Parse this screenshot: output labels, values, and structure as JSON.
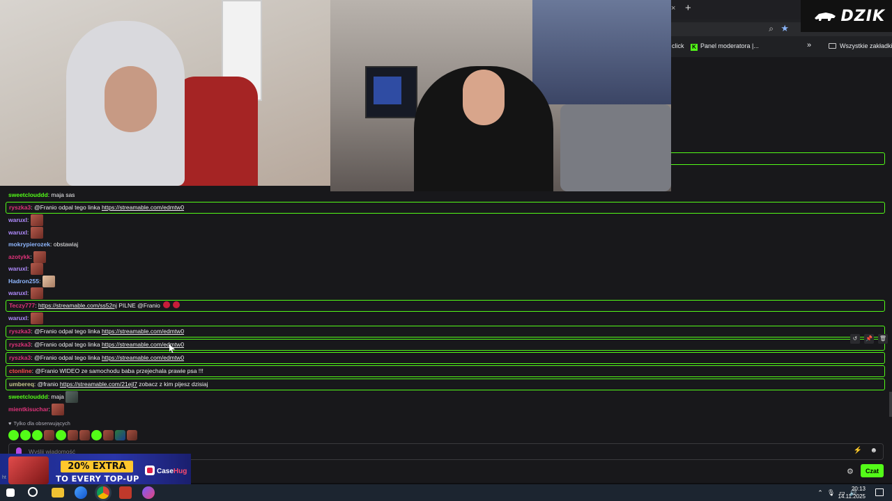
{
  "browser": {
    "tab_close": "×",
    "new_tab": "+",
    "bookmarks": {
      "click": "click",
      "panel": "Panel moderatora |...",
      "more": "»",
      "all": "Wszystkie zakładki"
    }
  },
  "overlay": {
    "brand": "DZIK"
  },
  "chat": {
    "messages": [
      {
        "user": "sweetclouddd",
        "text": "maja sas",
        "color": "#53fc18"
      },
      {
        "user": "ryszka3",
        "text": "@Franio odpal tego linka ",
        "link": "https://streamable.com/edmtw0",
        "highlight": true
      },
      {
        "user": "waruxl",
        "emote": true
      },
      {
        "user": "waruxl",
        "emote": true
      },
      {
        "user": "mokrypierozek",
        "text": "obstawiaj"
      },
      {
        "user": "azotykk",
        "emote": true
      },
      {
        "user": "waruxl",
        "emote": true
      },
      {
        "user": "Hadron255",
        "emote": true
      },
      {
        "user": "waruxl",
        "emote": true
      },
      {
        "user": "Teczy777",
        "link": "https://streamable.com/ss52nj",
        "text_after": " PILNE @Franio",
        "highlight": true
      },
      {
        "user": "waruxl",
        "emote": true
      },
      {
        "user": "ryszka3",
        "text": "@Franio odpal tego linka ",
        "link": "https://streamable.com/edmtw0",
        "highlight": true
      },
      {
        "user": "ryszka3",
        "text": "@Franio odpal tego linka ",
        "link": "https://streamable.com/edmtw0",
        "highlight": true
      },
      {
        "user": "ryszka3",
        "text": "@Franio odpal tego linka ",
        "link": "https://streamable.com/edmtw0",
        "highlight": true
      },
      {
        "user": "ctonline",
        "text": "@Franio WIDEO ze samochodu baba przejechala prawie psa !!!",
        "highlight": true
      },
      {
        "user": "umbereq",
        "text": "@franio ",
        "link": "https://streamable.com/21ejl7",
        "text_after": " zobacz z kim pijesz dzisiaj",
        "highlight": true
      },
      {
        "user": "sweetclouddd",
        "text": "maja",
        "emote": true
      },
      {
        "user": "mientkisuchar",
        "emote": true
      }
    ],
    "follow_note": "Tylko dla obserwujących",
    "input_placeholder": "Wyślij wiadomość",
    "send_label": "Czat",
    "actions": [
      "↺",
      "📌",
      "🗑"
    ]
  },
  "ad": {
    "badge": "20% EXTRA",
    "sub": "TO EVERY TOP-UP",
    "brand_a": "Case",
    "brand_b": "Hug",
    "url_fragment": "ht"
  },
  "taskbar": {
    "time": "20:13",
    "date": "14.11.2025"
  },
  "colors": {
    "accent": "#53fc18",
    "background": "#18181b"
  }
}
